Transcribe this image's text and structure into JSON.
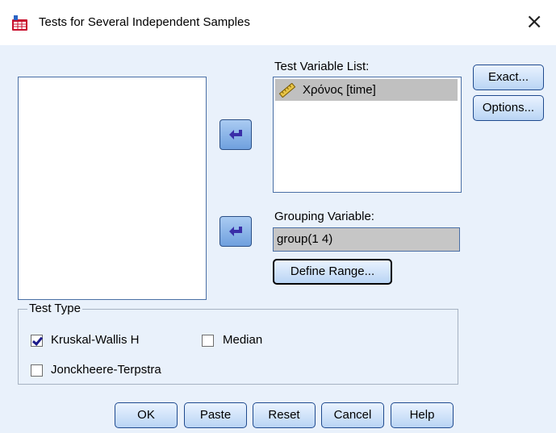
{
  "window": {
    "title": "Tests for Several Independent Samples",
    "close_glyph": "×",
    "icon": "spss-table-icon"
  },
  "test_variable_list": {
    "label": "Test Variable List:",
    "items": [
      {
        "label": "Χρόνος [time]",
        "icon": "ruler-icon",
        "selected": true
      }
    ]
  },
  "grouping_variable": {
    "label": "Grouping Variable:",
    "value": "group(1 4)"
  },
  "buttons": {
    "exact": "Exact...",
    "options": "Options...",
    "define_range": "Define Range...",
    "ok": "OK",
    "paste": "Paste",
    "reset": "Reset",
    "cancel": "Cancel",
    "help": "Help"
  },
  "test_type": {
    "legend": "Test Type",
    "options": [
      {
        "label": "Kruskal-Wallis H",
        "checked": true
      },
      {
        "label": "Median",
        "checked": false
      },
      {
        "label": "Jonckheere-Terpstra",
        "checked": false
      }
    ]
  },
  "colors": {
    "dialog_bg": "#e9f1fb",
    "selection": "#c0c0c0",
    "accent": "#6fa0de"
  }
}
